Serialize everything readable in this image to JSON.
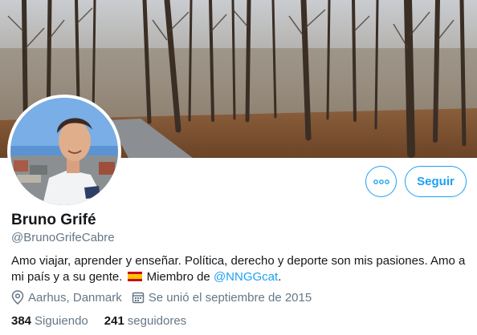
{
  "profile": {
    "name": "Bruno Grifé",
    "handle": "@BrunoGrifeCabre",
    "bio_text_1": "Amo viajar, aprender y enseñar. Política, derecho y deporte son mis pasiones. Amo a mi país y a su gente.",
    "bio_text_2": "Miembro de",
    "bio_mention": "@NNGGcat",
    "bio_text_3": ".",
    "location": "Aarhus, Danmark",
    "joined": "Se unió el septiembre de 2015"
  },
  "actions": {
    "follow_label": "Seguir"
  },
  "stats": {
    "following_count": "384",
    "following_label": "Siguiendo",
    "followers_count": "241",
    "followers_label": "seguidores"
  },
  "colors": {
    "accent": "#1da1f2",
    "secondary_text": "#657786",
    "primary_text": "#14171a"
  },
  "icons": {
    "more": "more-dots-icon",
    "location": "location-pin-icon",
    "calendar": "calendar-icon",
    "flag": "spain-flag-icon"
  }
}
